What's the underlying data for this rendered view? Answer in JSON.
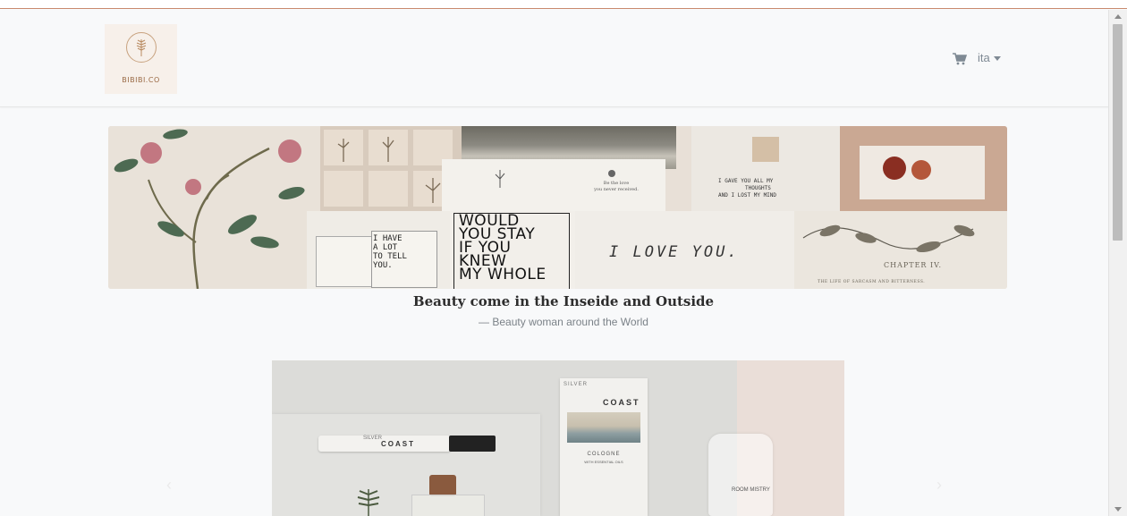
{
  "brand": {
    "logo_text": "BIBIBI.CO"
  },
  "nav": {
    "cart_icon": "cart-icon",
    "language_label": "ita"
  },
  "banner": {
    "notes": {
      "would_you_stay": [
        "WOULD",
        "YOU STAY",
        "IF YOU",
        "KNEW",
        "MY WHOLE"
      ],
      "i_have": [
        "I HAVE",
        "A LOT",
        "TO TELL",
        "YOU."
      ],
      "i_love_you": "I LOVE YOU.",
      "gave_you": [
        "I GAVE YOU ALL MY",
        "THOUGHTS",
        "AND I LOST MY MIND"
      ],
      "chapter": "CHAPTER IV.",
      "chapter_sub": "THE LIFE OF SARCASM AND BITTERNESS.",
      "be_the_love": [
        "Be the love",
        "you never received."
      ]
    }
  },
  "quote": {
    "text": "Beauty come in the Inseide and Outside",
    "author": "— Beauty woman around the World"
  },
  "carousel": {
    "product_label_1": "COAST",
    "product_label_2": "COAST",
    "product_sub": "COLOGNE",
    "product_sub2": "WITH ESSENTIAL OILS",
    "brand_small": "SILVER",
    "mist_label": "ROOM MISTRY"
  },
  "colors": {
    "accent_line": "#c98a6e",
    "page_bg": "#f8f9fa"
  }
}
